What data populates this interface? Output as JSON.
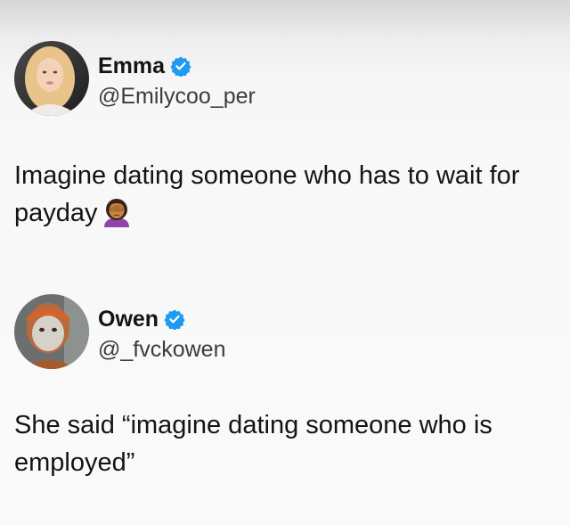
{
  "posts": [
    {
      "display_name": "Emma",
      "handle": "@Emilycoo_per",
      "text": "Imagine dating someone who has to wait for payday",
      "emoji": "woman-facepalming-icon",
      "verified": true
    },
    {
      "display_name": "Owen",
      "handle": "@_fvckowen",
      "text": "She said “imagine dating someone who is employed”",
      "verified": true
    }
  ],
  "colors": {
    "verified_blue": "#1d9bf0",
    "text": "#141414",
    "handle": "#3c3c3c"
  }
}
